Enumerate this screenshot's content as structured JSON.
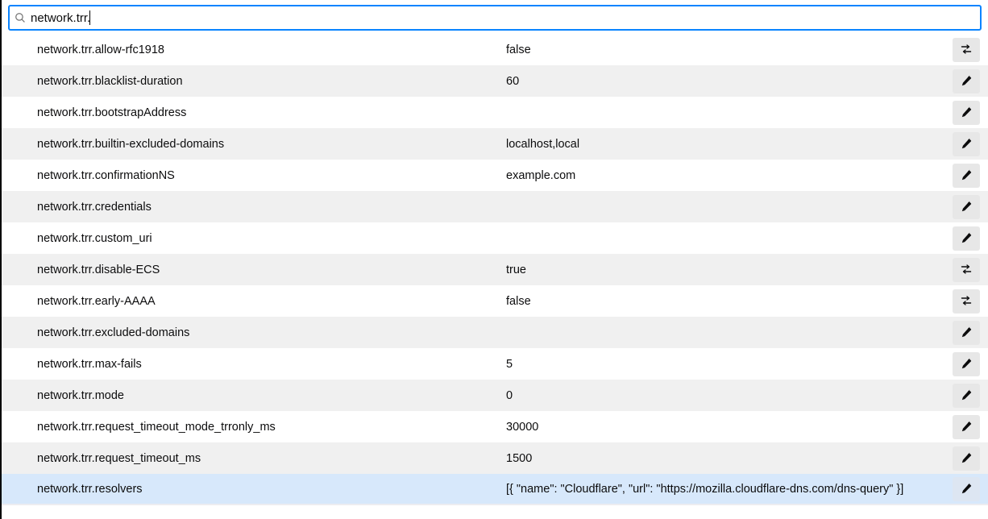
{
  "search": {
    "value": "network.trr."
  },
  "prefs": [
    {
      "name": "network.trr.allow-rfc1918",
      "value": "false",
      "action": "toggle"
    },
    {
      "name": "network.trr.blacklist-duration",
      "value": "60",
      "action": "edit"
    },
    {
      "name": "network.trr.bootstrapAddress",
      "value": "",
      "action": "edit"
    },
    {
      "name": "network.trr.builtin-excluded-domains",
      "value": "localhost,local",
      "action": "edit"
    },
    {
      "name": "network.trr.confirmationNS",
      "value": "example.com",
      "action": "edit"
    },
    {
      "name": "network.trr.credentials",
      "value": "",
      "action": "edit"
    },
    {
      "name": "network.trr.custom_uri",
      "value": "",
      "action": "edit"
    },
    {
      "name": "network.trr.disable-ECS",
      "value": "true",
      "action": "toggle"
    },
    {
      "name": "network.trr.early-AAAA",
      "value": "false",
      "action": "toggle"
    },
    {
      "name": "network.trr.excluded-domains",
      "value": "",
      "action": "edit"
    },
    {
      "name": "network.trr.max-fails",
      "value": "5",
      "action": "edit"
    },
    {
      "name": "network.trr.mode",
      "value": "0",
      "action": "edit"
    },
    {
      "name": "network.trr.request_timeout_mode_trronly_ms",
      "value": "30000",
      "action": "edit"
    },
    {
      "name": "network.trr.request_timeout_ms",
      "value": "1500",
      "action": "edit"
    },
    {
      "name": "network.trr.resolvers",
      "value": "[{ \"name\": \"Cloudflare\", \"url\": \"https://mozilla.cloudflare-dns.com/dns-query\" }]",
      "action": "edit",
      "highlight": true
    }
  ],
  "icons": {
    "toggle_alt": "toggle",
    "edit_alt": "edit"
  }
}
